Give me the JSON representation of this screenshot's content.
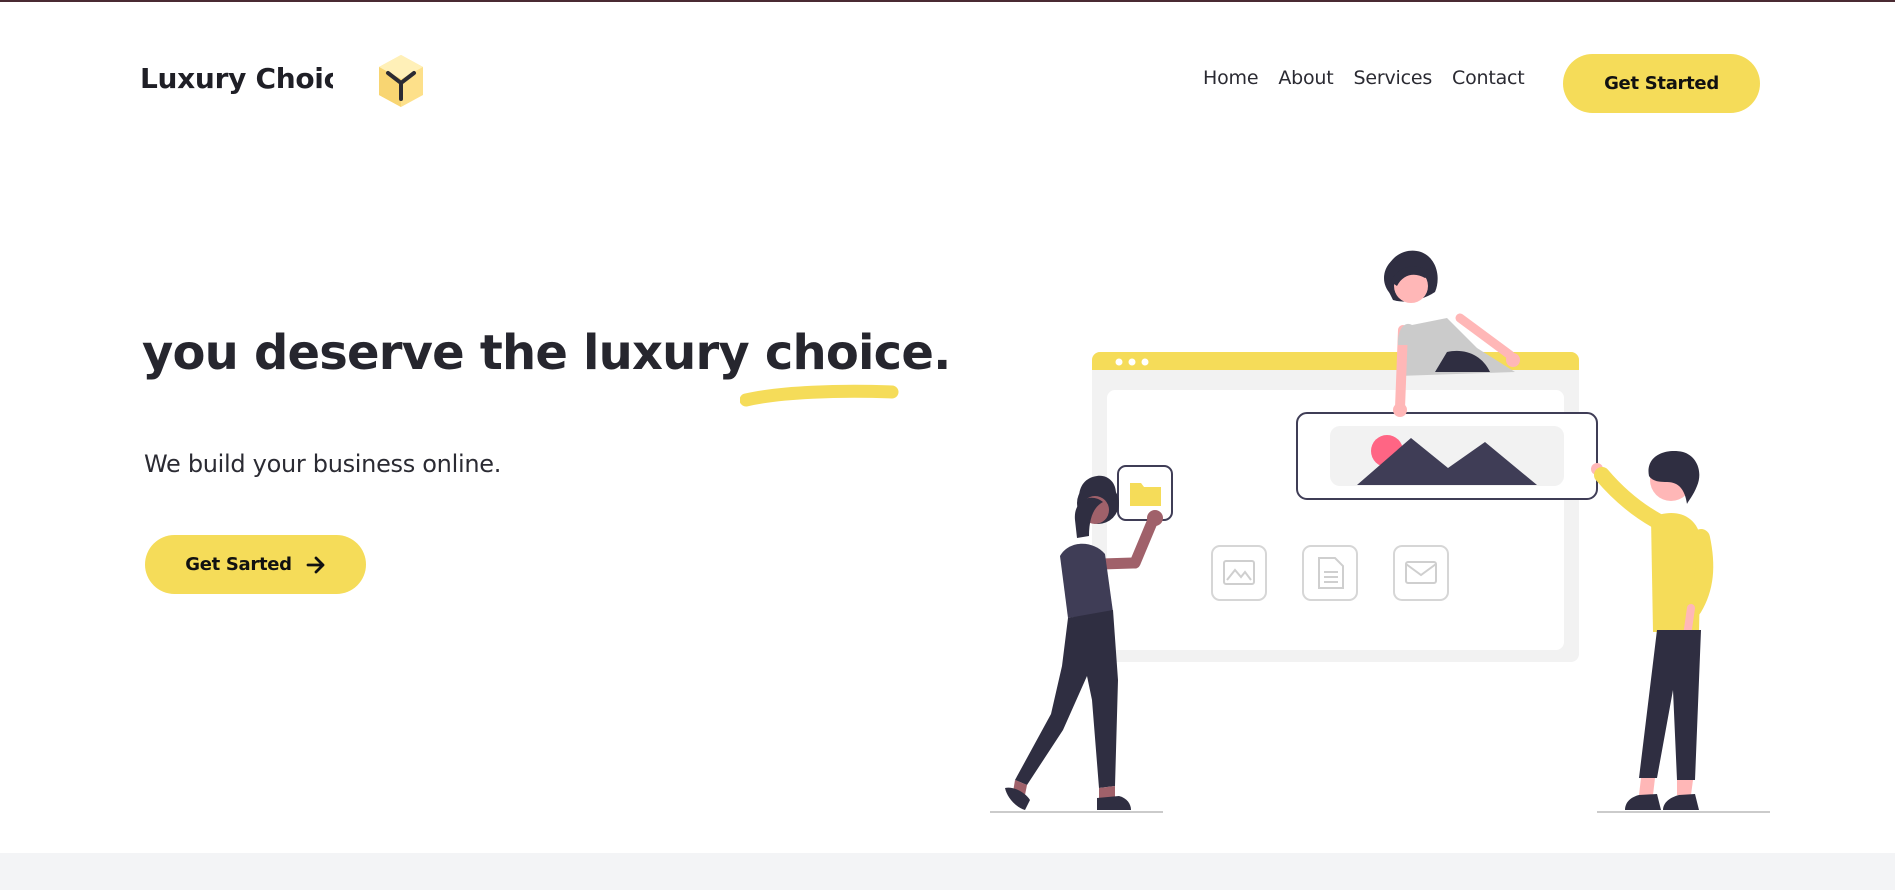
{
  "brand": {
    "name": "Luxury Choice",
    "logo_icon": "cube-logo-icon"
  },
  "nav": {
    "items": [
      {
        "label": "Home"
      },
      {
        "label": "About"
      },
      {
        "label": "Services"
      },
      {
        "label": "Contact"
      }
    ],
    "cta_label": "Get Started"
  },
  "hero": {
    "title": "you deserve the luxury choice.",
    "subtitle": "We build your business online.",
    "cta_label": "Get Sarted",
    "cta_icon": "arrow-right-icon",
    "illustration": "team-building-website-illustration"
  },
  "colors": {
    "accent": "#f5dc59",
    "text": "#26262e",
    "dark_figure": "#2f2e41",
    "band": "#f3f4f6"
  }
}
